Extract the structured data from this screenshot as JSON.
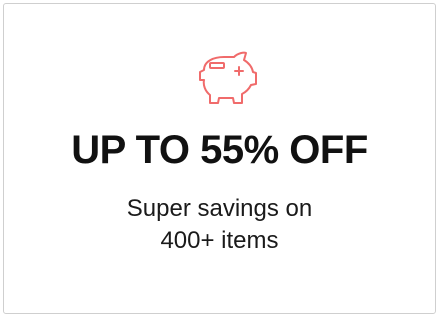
{
  "promo_card": {
    "icon": "piggy-bank-icon",
    "accent_color": "#f06b6b",
    "headline": "UP TO 55% OFF",
    "subtext_line1": "Super savings on",
    "subtext_line2": "400+ items"
  }
}
